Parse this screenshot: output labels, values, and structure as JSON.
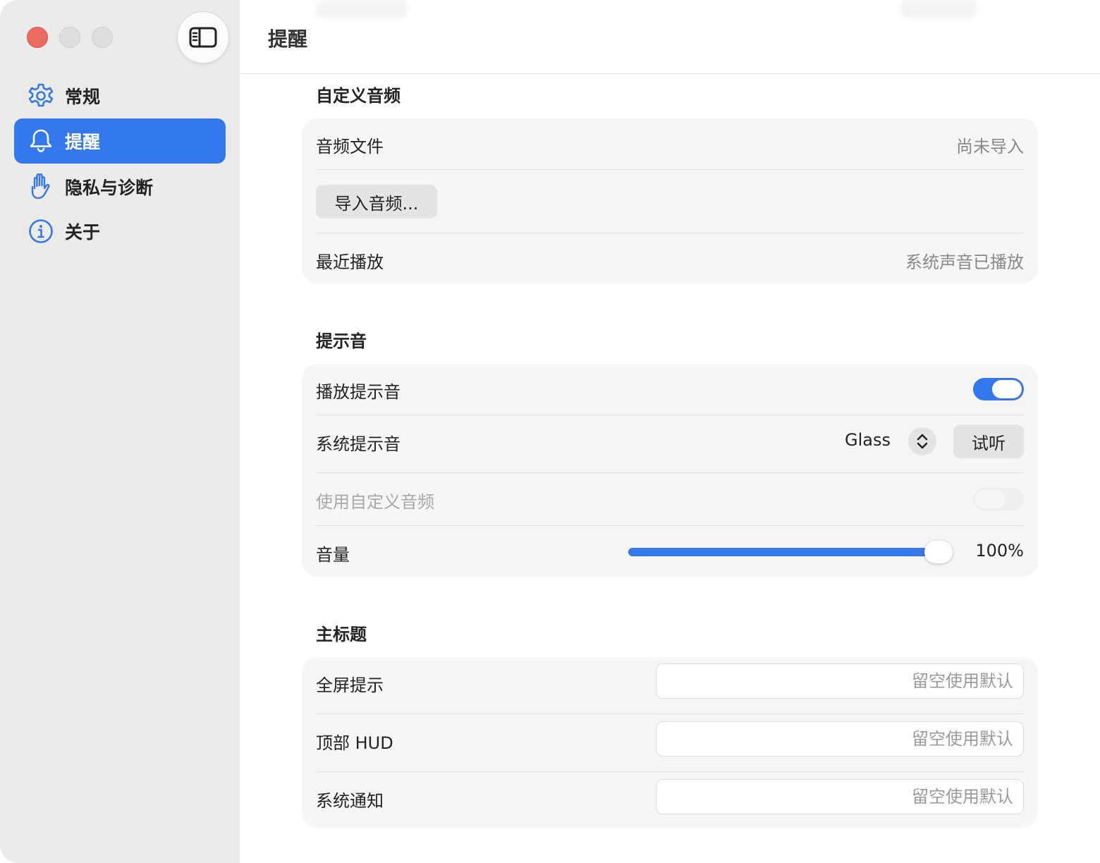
{
  "sidebar": {
    "items": [
      {
        "label": "常规",
        "icon": "gear-icon"
      },
      {
        "label": "提醒",
        "icon": "bell-icon",
        "active": true
      },
      {
        "label": "隐私与诊断",
        "icon": "hand-icon"
      },
      {
        "label": "关于",
        "icon": "info-icon"
      }
    ]
  },
  "header": {
    "title": "提醒"
  },
  "custom_audio": {
    "title": "自定义音频",
    "file_label": "音频文件",
    "file_value": "尚未导入",
    "import_button": "导入音频...",
    "recent_label": "最近播放",
    "recent_value": "系统声音已播放"
  },
  "alert_sound": {
    "title": "提示音",
    "play_label": "播放提示音",
    "play_on": true,
    "system_label": "系统提示音",
    "system_value": "Glass",
    "listen_button": "试听",
    "custom_label": "使用自定义音频",
    "custom_on": false,
    "volume_label": "音量",
    "volume_value": "100%",
    "volume_level": 1.0
  },
  "main_title": {
    "title": "主标题",
    "fields": [
      {
        "label": "全屏提示",
        "placeholder": "留空使用默认",
        "value": ""
      },
      {
        "label": "顶部 HUD",
        "placeholder": "留空使用默认",
        "value": ""
      },
      {
        "label": "系统通知",
        "placeholder": "留空使用默认",
        "value": ""
      }
    ]
  },
  "colors": {
    "accent": "#3478ee",
    "close": "#ec6a5e"
  }
}
